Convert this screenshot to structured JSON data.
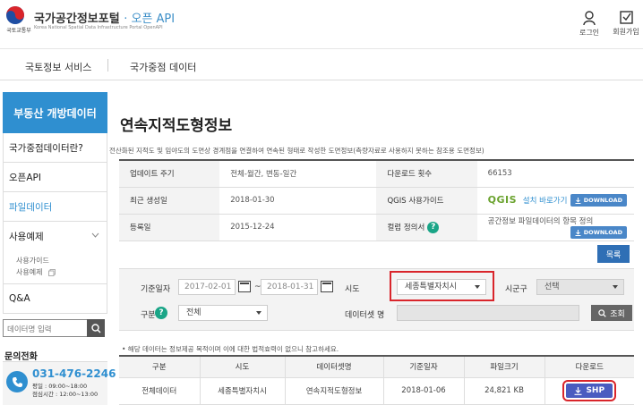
{
  "header": {
    "ministry": "국토교통부",
    "portal_title": "국가공간정보포털",
    "portal_api": "· 오픈 API",
    "portal_subtitle": "Korea National Spatial Data Infrastructure Portal OpenAPI",
    "login_label": "로그인",
    "signup_label": "회원가입"
  },
  "nav": {
    "items": [
      "국토정보 서비스",
      "국가중점 데이터"
    ]
  },
  "sidebar": {
    "title": "부동산 개방데이터",
    "items": [
      {
        "label": "국가중점데이터란?"
      },
      {
        "label": "오픈API"
      },
      {
        "label": "파일데이터"
      },
      {
        "label": "사용예제"
      },
      {
        "label": "Q&A"
      }
    ],
    "sub_items": [
      "사용가이드",
      "사용예제"
    ],
    "search_placeholder": "데이터명 입력",
    "contact_title": "문의전화",
    "phone": "031-476-2246",
    "hours_weekday": "평일 : 09:00~18:00",
    "hours_lunch": "점심시간 : 12:00~13:00"
  },
  "main": {
    "title": "연속지적도형정보",
    "description": "전산화된 지적도 및 임야도의 도면상 경계점을 연결하여 연속된 형태로 작성한 도면정보(측량자료로 사용하지 못하는 참조용 도면정보)",
    "info": {
      "update_cycle_label": "업데이트 주기",
      "update_cycle_value": "전체-월간, 변동-일간",
      "download_count_label": "다운로드 횟수",
      "download_count_value": "66153",
      "last_created_label": "최근 생성일",
      "last_created_value": "2018-01-30",
      "qgis_guide_label": "QGIS 사용가이드",
      "qgis_logo": "QGIS",
      "qgis_link": "설치 바로가기",
      "registered_label": "등록일",
      "registered_value": "2015-12-24",
      "column_def_label": "컬럼 정의서",
      "column_def_value": "공간정보 파일데이터의 항목 정의",
      "download_button": "DOWNLOAD"
    },
    "list_button": "목록",
    "filter": {
      "date_label": "기준일자",
      "date_from": "2017-02-01",
      "date_sep": "~",
      "date_to": "2018-01-31",
      "sido_label": "시도",
      "sido_value": "세종특별자치시",
      "sigungu_label": "시군구",
      "sigungu_value": "선택",
      "type_label": "구분",
      "type_value": "전체",
      "dataset_label": "데이터셋 명",
      "search_button": "조회"
    },
    "notice": "• 해당 데이터는 정보제공 목적이며 이에 대한 법적효력이 없으니 참고하세요.",
    "results": {
      "headers": [
        "구분",
        "시도",
        "데이터셋명",
        "기준일자",
        "파일크기",
        "다운로드"
      ],
      "rows": [
        {
          "type": "전체데이터",
          "sido": "세종특별자치시",
          "dataset": "연속지적도형정보",
          "date": "2018-01-06",
          "size": "24,821 KB",
          "download": "SHP"
        }
      ]
    }
  },
  "colors": {
    "accent": "#2f8fd0",
    "highlight": "#d9252b",
    "qgis": "#6ba32f"
  }
}
